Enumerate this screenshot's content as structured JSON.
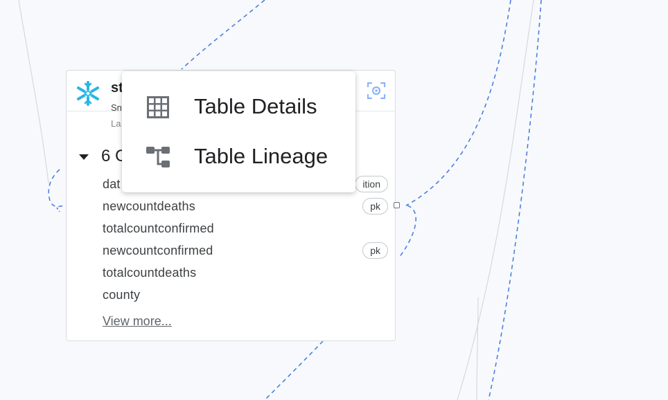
{
  "colors": {
    "canvas": "#f8f9fc",
    "edge": "#4a7fe0",
    "snowflake": "#29b5e8",
    "focus": "#8ab4f8"
  },
  "card": {
    "icon": "snowflake-icon",
    "title": "st",
    "subtitle": "Sn",
    "meta": "La",
    "focus_icon": "focus-icon",
    "columns_label": "6 C",
    "columns": [
      {
        "name": "dat",
        "badge": "ition"
      },
      {
        "name": "newcountdeaths",
        "badge": "pk"
      },
      {
        "name": "totalcountconfirmed",
        "badge": ""
      },
      {
        "name": "newcountconfirmed",
        "badge": "pk"
      },
      {
        "name": "totalcountdeaths",
        "badge": ""
      },
      {
        "name": "county",
        "badge": ""
      }
    ],
    "view_more": "View more..."
  },
  "context_menu": {
    "items": [
      {
        "label": "Table Details",
        "icon": "table-grid-icon"
      },
      {
        "label": "Table Lineage",
        "icon": "lineage-icon"
      }
    ]
  }
}
